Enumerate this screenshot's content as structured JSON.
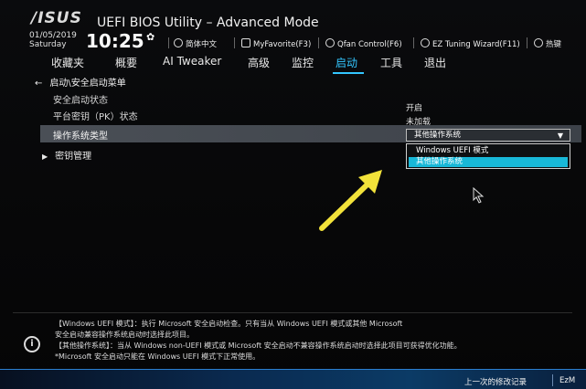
{
  "header": {
    "logo": "/ISUS",
    "title": "UEFI BIOS Utility – Advanced Mode",
    "date": "01/05/2019",
    "weekday": "Saturday",
    "time": "10:25",
    "buttons": [
      {
        "label": "简体中文",
        "icon": "globe-icon"
      },
      {
        "label": "MyFavorite(F3)",
        "icon": "favorite-icon"
      },
      {
        "label": "Qfan Control(F6)",
        "icon": "fan-icon"
      },
      {
        "label": "EZ Tuning Wizard(F11)",
        "icon": "bulb-icon"
      },
      {
        "label": "热键",
        "icon": "help-icon"
      }
    ]
  },
  "tabs": [
    {
      "label": "收藏夹"
    },
    {
      "label": "概要"
    },
    {
      "label": "AI Tweaker"
    },
    {
      "label": "高级"
    },
    {
      "label": "监控"
    },
    {
      "label": "启动",
      "active": true
    },
    {
      "label": "工具"
    },
    {
      "label": "退出"
    }
  ],
  "breadcrumb": "启动\\安全启动菜单",
  "rows": {
    "secure_boot_state": {
      "label": "安全启动状态",
      "value": "开启"
    },
    "platform_key": {
      "label": "平台密钥（PK）状态",
      "value": "未加载"
    },
    "os_type": {
      "label": "操作系统类型",
      "value": "其他操作系统"
    },
    "key_management": {
      "label": "密钥管理"
    }
  },
  "dropdown": {
    "options": [
      "Windows UEFI 模式",
      "其他操作系统"
    ],
    "highlighted_index": 1
  },
  "help": {
    "lines": [
      "【Windows UEFI 模式】：执行 Microsoft 安全启动检查。只有当从 Windows UEFI 模式或其他 Microsoft",
      "安全启动兼容操作系统启动时选择此项目。",
      "【其他操作系统】：当从 Windows non-UEFI 模式或 Microsoft 安全启动不兼容操作系统启动时选择此项目可获得优化功能。",
      "*Microsoft 安全启动只能在 Windows UEFI 模式下正常使用。"
    ]
  },
  "footer": {
    "last_modified": "上一次的修改记录",
    "ezmode": "EzM"
  },
  "colors": {
    "accent": "#33c6ff",
    "highlight": "#18b8d8",
    "selection_row": "#4a4f56",
    "arrow": "#f2e23a"
  }
}
